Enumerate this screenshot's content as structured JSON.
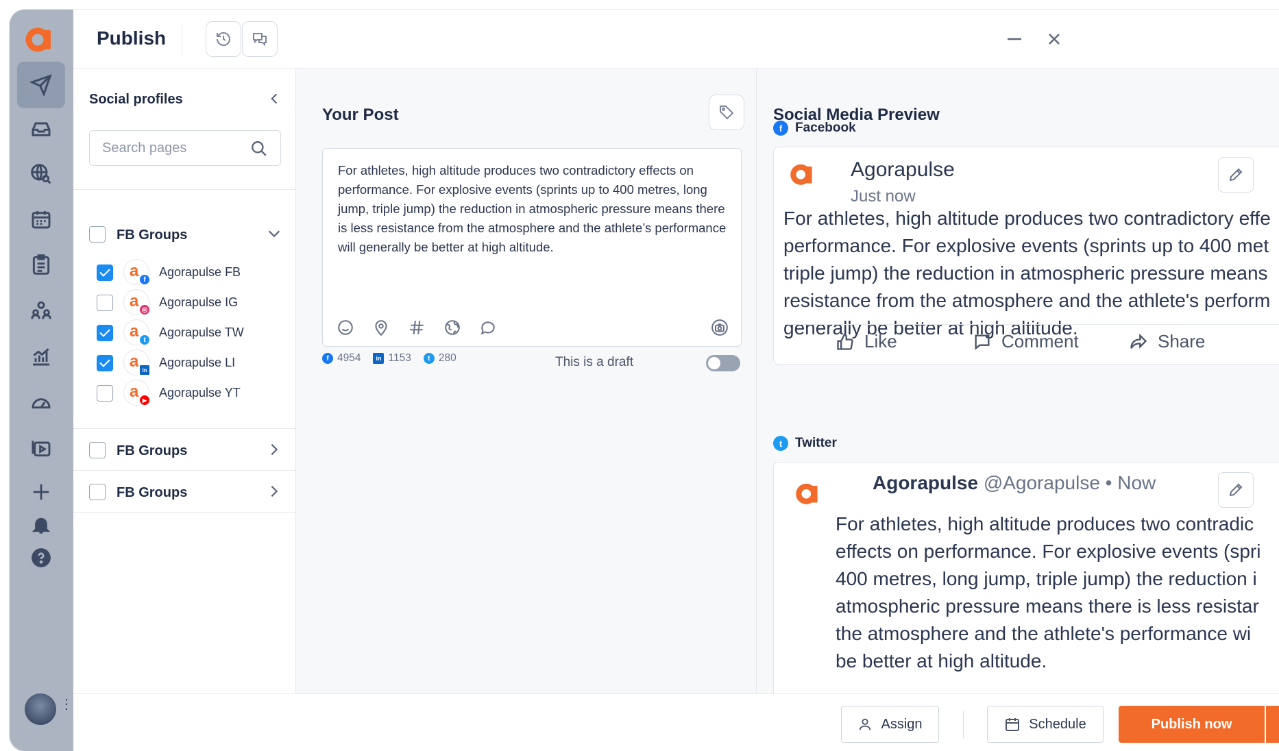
{
  "header": {
    "title": "Publish"
  },
  "rail": {
    "logo_letter": "a",
    "items": [
      "send-icon",
      "inbox-icon",
      "globe-search-icon",
      "calendar-icon",
      "list-icon",
      "users-icon",
      "reports-icon",
      "gauge-icon",
      "media-library-icon",
      "add-icon",
      "bell-icon",
      "help-icon"
    ]
  },
  "profiles": {
    "title": "Social profiles",
    "search_placeholder": "Search pages",
    "groups": [
      {
        "label": "FB Groups",
        "checked": false,
        "expanded": true
      },
      {
        "label": "FB Groups",
        "checked": false,
        "expanded": false
      },
      {
        "label": "FB Groups",
        "checked": false,
        "expanded": false
      }
    ],
    "items": [
      {
        "label": "Agorapulse FB",
        "checked": true,
        "network": "facebook",
        "color": "#1877f2",
        "glyph": "f"
      },
      {
        "label": "Agorapulse IG",
        "checked": false,
        "network": "instagram",
        "color": "#e1306c",
        "glyph": "◎"
      },
      {
        "label": "Agorapulse TW",
        "checked": true,
        "network": "twitter",
        "color": "#1d9bf0",
        "glyph": "t"
      },
      {
        "label": "Agorapulse LI",
        "checked": true,
        "network": "linkedin",
        "color": "#0a66c2",
        "glyph": "in"
      },
      {
        "label": "Agorapulse YT",
        "checked": false,
        "network": "youtube",
        "color": "#ff0000",
        "glyph": "▶"
      }
    ]
  },
  "post": {
    "title": "Your Post",
    "text": "For athletes, high altitude produces two contradictory effects on performance. For explosive events (sprints up to 400 metres, long jump, triple jump) the reduction in atmospheric pressure means there is less resistance from the atmosphere and the athlete’s performance will generally be better at high altitude.",
    "counters": {
      "facebook": "4954",
      "linkedin": "1153",
      "twitter": "280"
    },
    "draft_label": "This is a draft",
    "draft_on": false
  },
  "preview": {
    "title": "Social Media Preview",
    "facebook": {
      "network_label": "Facebook",
      "account_name": "Agorapulse",
      "timestamp": "Just now",
      "lines": [
        "For athletes, high altitude produces two contradictory effe",
        "performance. For explosive events (sprints up to 400 met",
        "triple jump) the reduction in atmospheric pressure means",
        "resistance from the atmosphere and the athlete's perform",
        "generally be better at high altitude."
      ],
      "actions": {
        "like": "Like",
        "comment": "Comment",
        "share": "Share"
      }
    },
    "twitter": {
      "network_label": "Twitter",
      "account_name": "Agorapulse",
      "handle": "@Agorapulse",
      "time": "• Now",
      "lines": [
        "For athletes, high altitude produces two contradic",
        "effects on performance. For explosive events (spri",
        "400 metres, long jump, triple jump) the reduction i",
        "atmospheric pressure means there is less resistar",
        "the atmosphere and the athlete's performance wi",
        "be better at high altitude."
      ]
    }
  },
  "footer": {
    "assign": "Assign",
    "schedule": "Schedule",
    "publish_now": "Publish now"
  },
  "colors": {
    "brand": "#f26b2a",
    "rail": "#acb4c2",
    "checkbox_checked": "#1a8cf0"
  }
}
